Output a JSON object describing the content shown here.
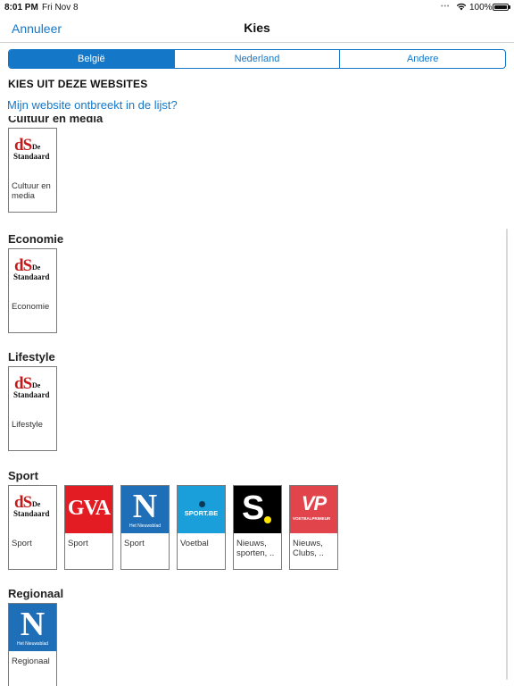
{
  "status_bar": {
    "time": "8:01 PM",
    "date": "Fri Nov 8",
    "battery": "100%",
    "wifi_icon": "wifi-icon",
    "battery_icon": "battery-icon"
  },
  "nav": {
    "cancel_label": "Annuleer",
    "title": "Kies"
  },
  "segments": [
    {
      "label": "België",
      "active": true
    },
    {
      "label": "Nederland",
      "active": false
    },
    {
      "label": "Andere",
      "active": false
    }
  ],
  "section_heading": "KIES UIT DEZE WEBSITES",
  "missing_link": "Mijn website ontbreekt in de lijst?",
  "categories": [
    {
      "title": "Cultuur en media",
      "tiles": [
        {
          "logo": "de-standaard-logo",
          "logo_text": {
            "d": "dS",
            "de": "De",
            "name": "Standaard"
          },
          "label": "Cultuur en media"
        }
      ]
    },
    {
      "title": "Economie",
      "tiles": [
        {
          "logo": "de-standaard-logo",
          "logo_text": {
            "d": "dS",
            "de": "De",
            "name": "Standaard"
          },
          "label": "Economie"
        }
      ]
    },
    {
      "title": "Lifestyle",
      "tiles": [
        {
          "logo": "de-standaard-logo",
          "logo_text": {
            "d": "dS",
            "de": "De",
            "name": "Standaard"
          },
          "label": "Lifestyle"
        }
      ]
    },
    {
      "title": "Sport",
      "tiles": [
        {
          "logo": "de-standaard-logo",
          "logo_text": {
            "d": "dS",
            "de": "De",
            "name": "Standaard"
          },
          "label": "Sport"
        },
        {
          "logo": "gva-logo",
          "logo_text": {
            "name": "GVA"
          },
          "label": "Sport"
        },
        {
          "logo": "het-nieuwsblad-logo",
          "logo_text": {
            "n": "N",
            "name": "Het Nieuwsblad"
          },
          "label": "Sport"
        },
        {
          "logo": "sport-be-logo",
          "logo_text": {
            "name": "SPORT.BE"
          },
          "label": "Voetbal"
        },
        {
          "logo": "sporza-logo",
          "logo_text": {
            "s": "S"
          },
          "label": "Nieuws, sporten, .."
        },
        {
          "logo": "voetbalprimeur-logo",
          "logo_text": {
            "vp": "VP",
            "name": "VOETBALPRIMEUR"
          },
          "label": "Nieuws, Clubs, .."
        }
      ]
    },
    {
      "title": "Regionaal",
      "tiles": [
        {
          "logo": "het-nieuwsblad-logo",
          "logo_text": {
            "n": "N",
            "name": "Het Nieuwsblad"
          },
          "label": "Regionaal"
        }
      ]
    }
  ],
  "colors": {
    "accent": "#1577c8",
    "gva_red": "#e31b23",
    "nieuwsblad_blue": "#1e6fb8",
    "sportbe_blue": "#1a9fda",
    "vp_red": "#e2444b"
  }
}
